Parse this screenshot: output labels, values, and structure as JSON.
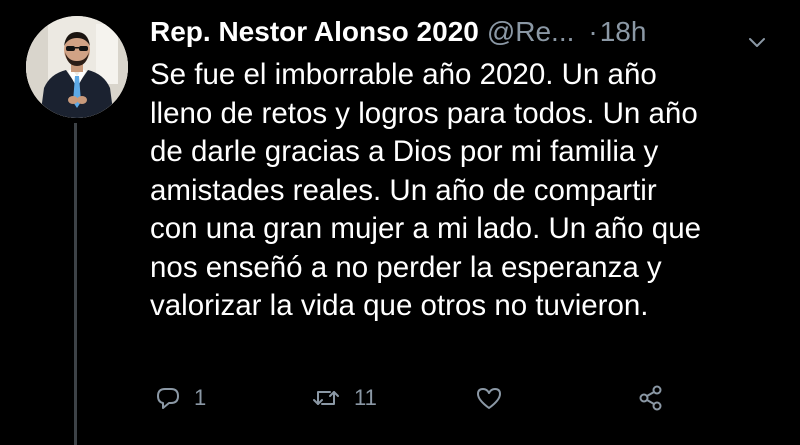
{
  "author": {
    "display_name": "Rep. Nestor Alonso 2020",
    "handle": "@Re...",
    "separator": "·",
    "time": "18h"
  },
  "tweet": {
    "lines": [
      "Se fue el imborrable año 2020. Un año",
      "lleno de retos y logros para todos. Un año",
      "de darle gracias a Dios por mi familia y",
      "amistades reales. Un año de compartir",
      "con una gran mujer a mi lado. Un año que",
      "nos enseñó a no perder la esperanza y",
      "valorizar la vida que otros no tuvieron."
    ]
  },
  "actions": {
    "reply_count": "1",
    "retweet_count": "11",
    "like_count": "",
    "icons": [
      "reply-icon",
      "retweet-icon",
      "like-icon",
      "share-icon"
    ]
  },
  "colors": {
    "background": "#000000",
    "text": "#ffffff",
    "secondary": "#8b98a5",
    "thread_line": "#3d4247"
  }
}
